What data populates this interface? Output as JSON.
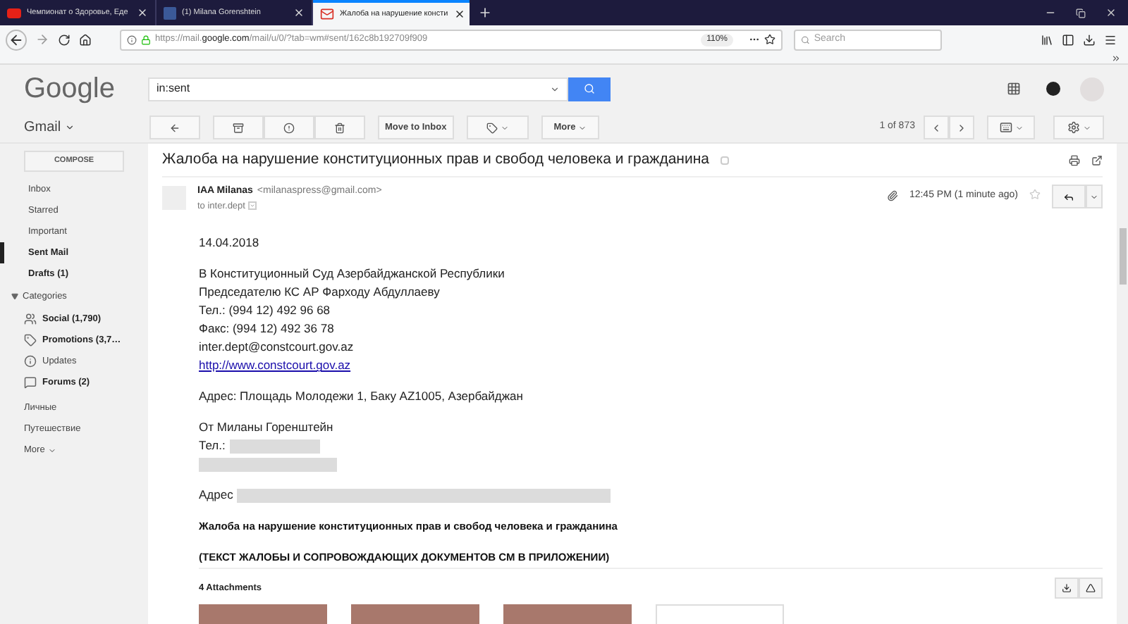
{
  "browser": {
    "tabs": [
      {
        "title": "Чемпионат о Здоровье, Еде",
        "kind": "video",
        "selected": false
      },
      {
        "title": "(1) Milana Gorenshtein",
        "kind": "social",
        "selected": false
      },
      {
        "title": "Жалоба на нарушение консти",
        "kind": "mail",
        "selected": true
      }
    ],
    "url_prefix": "https://mail.",
    "url_domain": "google.com",
    "url_path": "/mail/u/0/?tab=wm#sent/162c8b192709f909",
    "zoom": "110%",
    "search": {
      "placeholder": "Search"
    }
  },
  "gmail": {
    "logo": "Google",
    "search": {
      "value": "in:sent"
    },
    "app": "Gmail",
    "compose": "COMPOSE",
    "nav": [
      {
        "label": "Inbox",
        "bold": false,
        "selected": false
      },
      {
        "label": "Starred",
        "bold": false,
        "selected": false
      },
      {
        "label": "Important",
        "bold": false,
        "selected": false
      },
      {
        "label": "Sent Mail",
        "bold": true,
        "selected": true
      },
      {
        "label": "Drafts (1)",
        "bold": true,
        "selected": false
      }
    ],
    "categories": {
      "label": "Categories",
      "expanded": true,
      "items": [
        {
          "label": "Social (1,790)",
          "kind": "people",
          "bold": true
        },
        {
          "label": "Promotions (3,7…",
          "kind": "tag",
          "bold": true
        },
        {
          "label": "Updates",
          "kind": "info",
          "bold": false
        },
        {
          "label": "Forums (2)",
          "kind": "forum",
          "bold": true
        }
      ]
    },
    "labels": [
      "Личные",
      "Путешествие"
    ],
    "more": "More",
    "toolbar": {
      "move_to_inbox": "Move to Inbox",
      "more": "More",
      "pagination": "1 of 873"
    },
    "message": {
      "subject": "Жалоба на нарушение конституционных прав и свобод человека и гражданина",
      "sender": "IAA Milanas",
      "email": "<milanaspress@gmail.com>",
      "to": "to inter.dept",
      "time": "12:45 PM (1 minute ago)",
      "starred": false,
      "paragraphs": [
        [
          {
            "kind": "text",
            "text": "14.04.2018"
          }
        ],
        [
          {
            "kind": "text",
            "text": "В Конституционный Суд Азербайджанской Республики"
          },
          {
            "kind": "text",
            "text": "Председателю КС АР Фарходу Абдуллаеву"
          },
          {
            "kind": "text",
            "text": "Тел.: (994 12) 492 96 68"
          },
          {
            "kind": "text",
            "text": "Факс: (994 12) 492 36 78"
          },
          {
            "kind": "text",
            "text": "inter.dept@constcourt.gov.az"
          },
          {
            "kind": "link",
            "text": "http://www.constcourt.gov.az"
          }
        ],
        [
          {
            "kind": "text",
            "text": "Адрес: Площадь Молодежи 1, Баку AZ1005, Азербайджан"
          }
        ],
        [
          {
            "kind": "text",
            "text": "От Миланы Горенштейн"
          },
          {
            "kind": "redacted_short",
            "text": "Тел.:"
          },
          {
            "kind": "redacted_medium"
          }
        ],
        [
          {
            "kind": "redacted_long",
            "text": "Адрес"
          }
        ],
        [
          {
            "kind": "bold",
            "text": "Жалоба на нарушение конституционных прав и свобод человека и гражданина"
          }
        ],
        [
          {
            "kind": "bold",
            "text": "(ТЕКСТ ЖАЛОБЫ И СОПРОВОЖДАЮЩИХ ДОКУМЕНТОВ СМ В ПРИЛОЖЕНИИ)"
          }
        ]
      ],
      "attachments": {
        "title": "4 Attachments",
        "items": [
          {
            "kind": "photo"
          },
          {
            "kind": "photo"
          },
          {
            "kind": "photo"
          },
          {
            "kind": "document"
          }
        ]
      }
    }
  }
}
